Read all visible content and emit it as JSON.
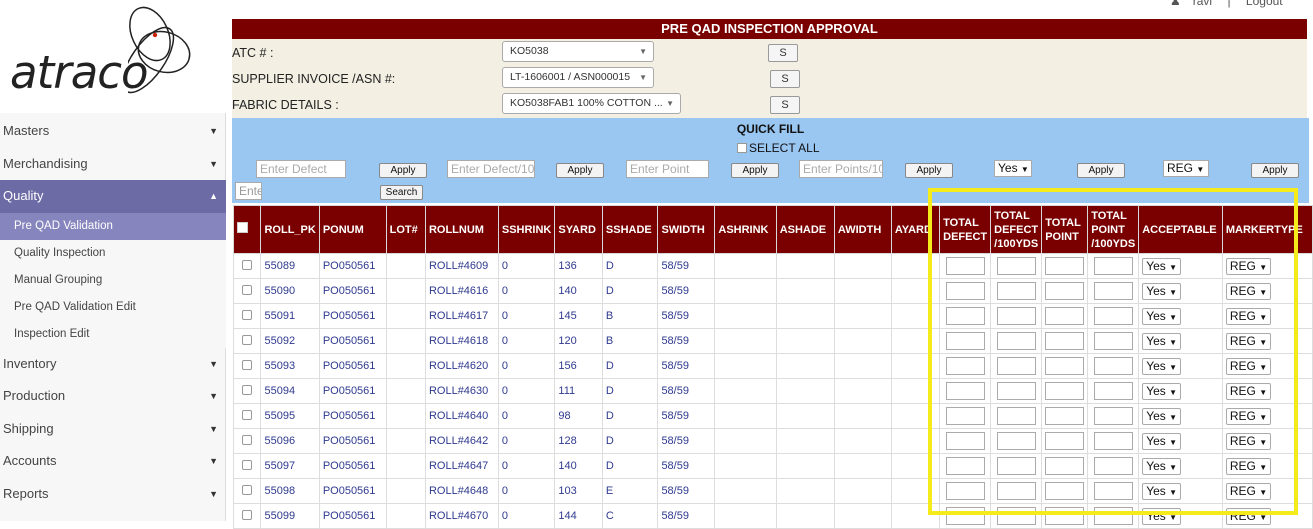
{
  "user": {
    "name": "ravi",
    "logout": "Logout",
    "sep": "|"
  },
  "logo": {
    "word": "atraco"
  },
  "nav": [
    {
      "label": "Masters",
      "name": "nav-masters"
    },
    {
      "label": "Merchandising",
      "name": "nav-merchandising"
    },
    {
      "label": "Quality",
      "name": "nav-quality",
      "active": true
    },
    {
      "label": "Inventory",
      "name": "nav-inventory"
    },
    {
      "label": "Production",
      "name": "nav-production"
    },
    {
      "label": "Shipping",
      "name": "nav-shipping"
    },
    {
      "label": "Accounts",
      "name": "nav-accounts"
    },
    {
      "label": "Reports",
      "name": "nav-reports"
    }
  ],
  "quality_sub": [
    {
      "label": "Pre QAD Validation",
      "selected": true
    },
    {
      "label": "Quality Inspection"
    },
    {
      "label": "Manual Grouping"
    },
    {
      "label": "Pre QAD Validation Edit"
    },
    {
      "label": "Inspection Edit"
    }
  ],
  "page": {
    "title": "PRE QAD INSPECTION APPROVAL"
  },
  "form": {
    "atc_label": "ATC # :",
    "atc_value": "KO5038",
    "supplier_label": "SUPPLIER INVOICE /ASN #:",
    "supplier_value": "LT-1606001 / ASN000015",
    "fabric_label": "FABRIC DETAILS :",
    "fabric_value": "KO5038FAB1 100% COTTON ...",
    "s_label": "S"
  },
  "quickfill": {
    "title": "QUICK FILL",
    "select_all": "SELECT ALL",
    "defect_placeholder": "Enter Defect",
    "defect100_placeholder": "Enter Defect/10",
    "point_placeholder": "Enter Point",
    "points100_placeholder": "Enter Points/10",
    "acceptable_value": "Yes",
    "marker_value": "REG",
    "apply": "Apply",
    "search": "Search",
    "small_placeholder": "Ente"
  },
  "columns": [
    "ROLL_PK",
    "PONUM",
    "LOT#",
    "ROLLNUM",
    "SSHRINK",
    "SYARD",
    "SSHADE",
    "SWIDTH",
    "ASHRINK",
    "ASHADE",
    "AWIDTH",
    "AYARD",
    "TOTAL DEFECT",
    "TOTAL DEFECT /100YDS",
    "TOTAL POINT",
    "TOTAL POINT /100YDS",
    "ACCEPTABLE",
    "MARKERTYPE"
  ],
  "rows": [
    {
      "roll_pk": "55089",
      "ponum": "PO050561",
      "lot": "",
      "rollnum": "ROLL#4609",
      "sshrink": "0",
      "syard": "136",
      "sshade": "D",
      "swidth": "58/59",
      "acceptable": "Yes",
      "marker": "REG"
    },
    {
      "roll_pk": "55090",
      "ponum": "PO050561",
      "lot": "",
      "rollnum": "ROLL#4616",
      "sshrink": "0",
      "syard": "140",
      "sshade": "D",
      "swidth": "58/59",
      "acceptable": "Yes",
      "marker": "REG"
    },
    {
      "roll_pk": "55091",
      "ponum": "PO050561",
      "lot": "",
      "rollnum": "ROLL#4617",
      "sshrink": "0",
      "syard": "145",
      "sshade": "B",
      "swidth": "58/59",
      "acceptable": "Yes",
      "marker": "REG"
    },
    {
      "roll_pk": "55092",
      "ponum": "PO050561",
      "lot": "",
      "rollnum": "ROLL#4618",
      "sshrink": "0",
      "syard": "120",
      "sshade": "B",
      "swidth": "58/59",
      "acceptable": "Yes",
      "marker": "REG"
    },
    {
      "roll_pk": "55093",
      "ponum": "PO050561",
      "lot": "",
      "rollnum": "ROLL#4620",
      "sshrink": "0",
      "syard": "156",
      "sshade": "D",
      "swidth": "58/59",
      "acceptable": "Yes",
      "marker": "REG"
    },
    {
      "roll_pk": "55094",
      "ponum": "PO050561",
      "lot": "",
      "rollnum": "ROLL#4630",
      "sshrink": "0",
      "syard": "111",
      "sshade": "D",
      "swidth": "58/59",
      "acceptable": "Yes",
      "marker": "REG"
    },
    {
      "roll_pk": "55095",
      "ponum": "PO050561",
      "lot": "",
      "rollnum": "ROLL#4640",
      "sshrink": "0",
      "syard": "98",
      "sshade": "D",
      "swidth": "58/59",
      "acceptable": "Yes",
      "marker": "REG"
    },
    {
      "roll_pk": "55096",
      "ponum": "PO050561",
      "lot": "",
      "rollnum": "ROLL#4642",
      "sshrink": "0",
      "syard": "128",
      "sshade": "D",
      "swidth": "58/59",
      "acceptable": "Yes",
      "marker": "REG"
    },
    {
      "roll_pk": "55097",
      "ponum": "PO050561",
      "lot": "",
      "rollnum": "ROLL#4647",
      "sshrink": "0",
      "syard": "140",
      "sshade": "D",
      "swidth": "58/59",
      "acceptable": "Yes",
      "marker": "REG"
    },
    {
      "roll_pk": "55098",
      "ponum": "PO050561",
      "lot": "",
      "rollnum": "ROLL#4648",
      "sshrink": "0",
      "syard": "103",
      "sshade": "E",
      "swidth": "58/59",
      "acceptable": "Yes",
      "marker": "REG"
    },
    {
      "roll_pk": "55099",
      "ponum": "PO050561",
      "lot": "",
      "rollnum": "ROLL#4670",
      "sshrink": "0",
      "syard": "144",
      "sshade": "C",
      "swidth": "58/59",
      "acceptable": "Yes",
      "marker": "REG"
    }
  ],
  "colors": {
    "header_bg": "#7a0000",
    "quickfill_bg": "#9ac7f2",
    "form_bg": "#f3efe3",
    "nav_active": "#6d6ba6",
    "highlight": "#f5ea1a"
  }
}
